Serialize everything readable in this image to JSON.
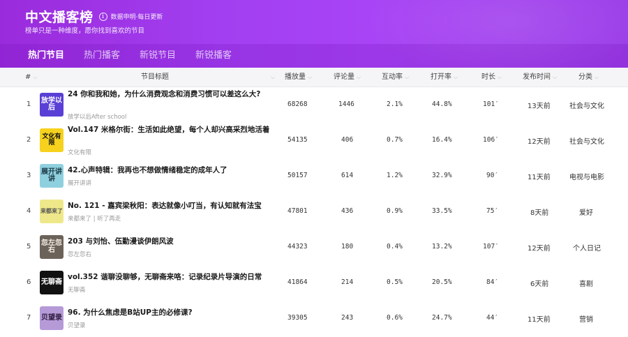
{
  "header": {
    "title": "中文播客榜",
    "update_note": "数据申明·每日更新",
    "subtitle": "榜单只是一种维度，愿你找到喜欢的节目"
  },
  "tabs": [
    {
      "label": "热门节目",
      "active": true
    },
    {
      "label": "热门播客",
      "active": false
    },
    {
      "label": "新锐节目",
      "active": false
    },
    {
      "label": "新锐播客",
      "active": false
    }
  ],
  "columns": {
    "rank": "#",
    "title": "节目标题",
    "plays": "播放量",
    "comments": "评论量",
    "interaction": "互动率",
    "open_rate": "打开率",
    "duration": "时长",
    "published": "发布时间",
    "category": "分类"
  },
  "rows": [
    {
      "rank": "1",
      "title": "24 你和我和她，为什么消费观念和消费习惯可以差这么大?",
      "podcast": "放学以后After school",
      "plays": "68268",
      "comments": "1446",
      "interaction": "2.1%",
      "open_rate": "44.8%",
      "duration": "101′",
      "published": "13天前",
      "category": "社会与文化",
      "cover_text": "放学以后",
      "cover_bg": "#5a3fd6",
      "cover_fg": "#ffffff"
    },
    {
      "rank": "2",
      "title": "Vol.147 米格尔街：生活如此绝望，每个人却兴高采烈地活着",
      "podcast": "文化有限",
      "plays": "54135",
      "comments": "406",
      "interaction": "0.7%",
      "open_rate": "16.4%",
      "duration": "106′",
      "published": "12天前",
      "category": "社会与文化",
      "cover_text": "文化有限",
      "cover_bg": "#f6d21e",
      "cover_fg": "#111111"
    },
    {
      "rank": "3",
      "title": "42.心声特辑：我再也不想做情绪稳定的成年人了",
      "podcast": "展开讲讲",
      "plays": "50157",
      "comments": "614",
      "interaction": "1.2%",
      "open_rate": "32.9%",
      "duration": "90′",
      "published": "11天前",
      "category": "电视与电影",
      "cover_text": "展开讲讲",
      "cover_bg": "#8fd0df",
      "cover_fg": "#1b3a44"
    },
    {
      "rank": "4",
      "title": "No. 121 - 嘉宾梁秋阳：表达就像小叮当，有认知就有法宝",
      "podcast": "来都来了 | 听了再走",
      "plays": "47801",
      "comments": "436",
      "interaction": "0.9%",
      "open_rate": "33.5%",
      "duration": "75′",
      "published": "8天前",
      "category": "爱好",
      "cover_text": "来都来了",
      "cover_bg": "#efe88a",
      "cover_fg": "#555555"
    },
    {
      "rank": "5",
      "title": "203 与刘怡、伍勤漫谈伊朗风波",
      "podcast": "忽左忽右",
      "plays": "44323",
      "comments": "180",
      "interaction": "0.4%",
      "open_rate": "13.2%",
      "duration": "107′",
      "published": "12天前",
      "category": "个人日记",
      "cover_text": "忽左忽右",
      "cover_bg": "#6b6259",
      "cover_fg": "#f3ece2"
    },
    {
      "rank": "6",
      "title": "vol.352 谐聊没聊够，无聊斋来咯：记录纪录片导演的日常",
      "podcast": "无聊斋",
      "plays": "41864",
      "comments": "214",
      "interaction": "0.5%",
      "open_rate": "20.5%",
      "duration": "84′",
      "published": "6天前",
      "category": "喜剧",
      "cover_text": "无聊斋",
      "cover_bg": "#111111",
      "cover_fg": "#ffffff"
    },
    {
      "rank": "7",
      "title": "96. 为什么焦虑是B站UP主的必修课?",
      "podcast": "贝望录",
      "plays": "39305",
      "comments": "243",
      "interaction": "0.6%",
      "open_rate": "24.7%",
      "duration": "44′",
      "published": "11天前",
      "category": "营销",
      "cover_text": "贝望录",
      "cover_bg": "#b69ad8",
      "cover_fg": "#2a1a3a"
    }
  ]
}
